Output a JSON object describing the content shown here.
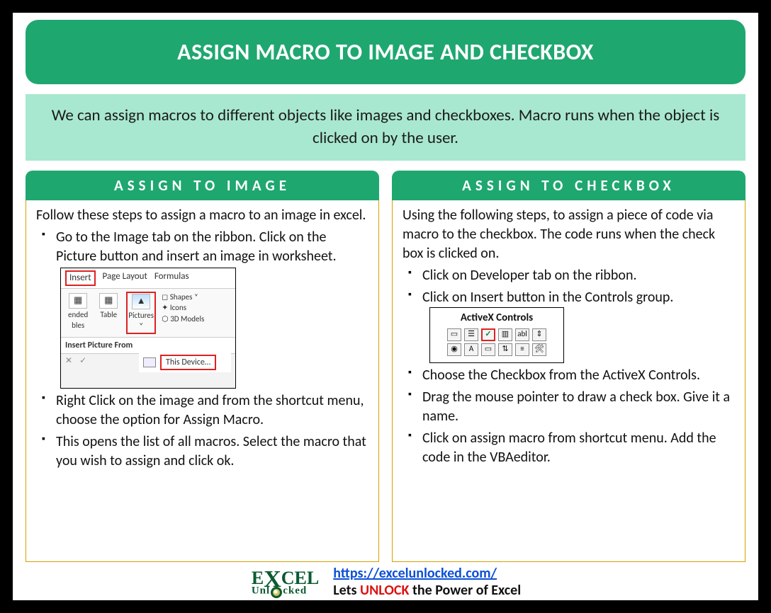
{
  "title": "ASSIGN MACRO TO IMAGE AND CHECKBOX",
  "intro": "We can assign macros to different objects like images and checkboxes. Macro runs when the object is clicked on by the user.",
  "left": {
    "heading": "ASSIGN TO IMAGE",
    "lead": "Follow these steps to assign a macro to an image in excel.",
    "step1_part1": "Go to the Image tab on the ribbon. Click on the Picture button and insert an image in worksheet.",
    "step2": "Right Click on the image and from the shortcut menu, choose the option for Assign Macro.",
    "step3": "This opens the list of all macros. Select the macro that you wish to assign and click ok.",
    "ribbon": {
      "tab_insert": "Insert",
      "tab_pagelayout": "Page Layout",
      "tab_formulas": "Formulas",
      "btn_ended": "ended",
      "btn_bles": "bles",
      "btn_table": "Table",
      "btn_pictures": "Pictures",
      "side_shapes": "Shapes ˅",
      "side_icons": "Icons",
      "side_3d": "3D Models",
      "sub": "Insert Picture From",
      "device": "This Device…",
      "foot_x": "✕",
      "foot_chk": "✓"
    }
  },
  "right": {
    "heading": "ASSIGN TO CHECKBOX",
    "lead": "Using the following steps, to assign a piece of code via macro to the checkbox. The code runs when the check box is clicked on.",
    "step1": "Click on Developer tab on the ribbon.",
    "step2_part1": "Click on Insert button in the Controls group.",
    "step3": "Choose the Checkbox from the ActiveX Controls.",
    "step4": "Drag the mouse pointer to draw a check box. Give it a name.",
    "step5": "Click on assign macro from shortcut menu. Add the code in the VBAeditor.",
    "ax_title": "ActiveX Controls"
  },
  "footer": {
    "logo_top": "E",
    "logo_x": "X",
    "logo_rest": "CEL",
    "logo_sub_pre": "Unl",
    "logo_sub_post": "cked",
    "link": "https://excelunlocked.com/",
    "tag_pre": "Lets ",
    "tag_red": "UNLOCK",
    "tag_post": " the Power of Excel"
  }
}
